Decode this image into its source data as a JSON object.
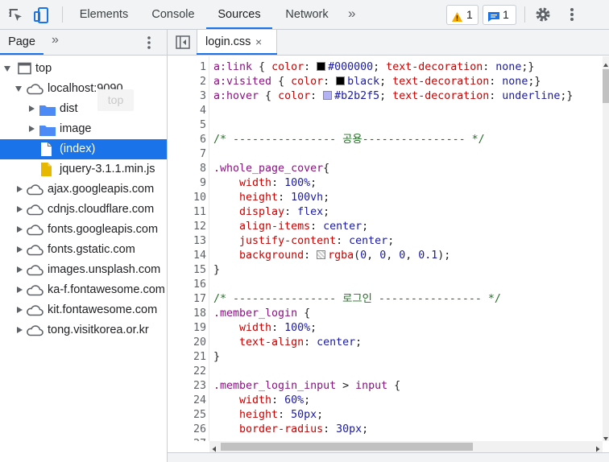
{
  "toolbar": {
    "inspect_icon": "element-picker-icon",
    "device_icon": "device-toolbar-icon",
    "tabs": [
      "Elements",
      "Console",
      "Sources",
      "Network"
    ],
    "active_tab": "Sources",
    "more_tabs": "»",
    "warnings_count": "1",
    "messages_count": "1",
    "settings_icon": "gear-icon",
    "menu_icon": "kebab-menu-icon"
  },
  "navigator": {
    "tab_label": "Page",
    "more": "»",
    "ghost_tooltip": "top",
    "tree": [
      {
        "label": "top",
        "kind": "frame",
        "expanded": true
      },
      {
        "label": "localhost:9090",
        "kind": "cloud",
        "expanded": true
      },
      {
        "label": "dist",
        "kind": "folder",
        "expanded": false
      },
      {
        "label": "image",
        "kind": "folder",
        "expanded": false
      },
      {
        "label": "(index)",
        "kind": "file",
        "selected": true
      },
      {
        "label": "jquery-3.1.1.min.js",
        "kind": "js-file"
      },
      {
        "label": "ajax.googleapis.com",
        "kind": "cloud"
      },
      {
        "label": "cdnjs.cloudflare.com",
        "kind": "cloud"
      },
      {
        "label": "fonts.googleapis.com",
        "kind": "cloud"
      },
      {
        "label": "fonts.gstatic.com",
        "kind": "cloud"
      },
      {
        "label": "images.unsplash.com",
        "kind": "cloud"
      },
      {
        "label": "ka-f.fontawesome.com",
        "kind": "cloud"
      },
      {
        "label": "kit.fontawesome.com",
        "kind": "cloud"
      },
      {
        "label": "tong.visitkorea.or.kr",
        "kind": "cloud"
      }
    ]
  },
  "editor": {
    "file_tab": "login.css",
    "close_glyph": "×",
    "line_numbers": [
      "1",
      "2",
      "3",
      "4",
      "5",
      "6",
      "7",
      "8",
      "9",
      "10",
      "11",
      "12",
      "13",
      "14",
      "15",
      "16",
      "17",
      "18",
      "19",
      "20",
      "21",
      "22",
      "23",
      "24",
      "25",
      "26",
      "27"
    ],
    "swatches": {
      "black": "#000000",
      "hover": "#b2b2f5",
      "rgba": "#e6e6e6"
    },
    "lines": {
      "l1": [
        "a:link",
        " { ",
        "color",
        ": ",
        "#000000",
        "; ",
        "text-decoration",
        ": ",
        "none",
        ";}"
      ],
      "l2": [
        "a:visited",
        " { ",
        "color",
        ": ",
        "black",
        "; ",
        "text-decoration",
        ": ",
        "none",
        ";}"
      ],
      "l3": [
        "a:hover",
        " { ",
        "color",
        ": ",
        "#b2b2f5",
        "; ",
        "text-decoration",
        ": ",
        "underline",
        ";}"
      ],
      "l6": "/* ---------------- 공용---------------- */",
      "l8": [
        ".whole_page_cover",
        "{"
      ],
      "l9": [
        "width",
        ": ",
        "100%",
        ";"
      ],
      "l10": [
        "height",
        ": ",
        "100vh",
        ";"
      ],
      "l11": [
        "display",
        ": ",
        "flex",
        ";"
      ],
      "l12": [
        "align-items",
        ": ",
        "center",
        ";"
      ],
      "l13": [
        "justify-content",
        ": ",
        "center",
        ";"
      ],
      "l14": [
        "background",
        ": ",
        "rgba",
        "(",
        "0",
        ", ",
        "0",
        ", ",
        "0",
        ", ",
        "0.1",
        ");"
      ],
      "l15": "}",
      "l17": "/* ---------------- 로그인 ---------------- */",
      "l18": [
        ".member_login",
        " {"
      ],
      "l19": [
        "width",
        ": ",
        "100%",
        ";"
      ],
      "l20": [
        "text-align",
        ": ",
        "center",
        ";"
      ],
      "l21": "}",
      "l23": [
        ".member_login_input",
        " > ",
        "input",
        " {"
      ],
      "l24": [
        "width",
        ": ",
        "60%",
        ";"
      ],
      "l25": [
        "height",
        ": ",
        "50px",
        ";"
      ],
      "l26": [
        "border-radius",
        ": ",
        "30px",
        ";"
      ]
    }
  }
}
